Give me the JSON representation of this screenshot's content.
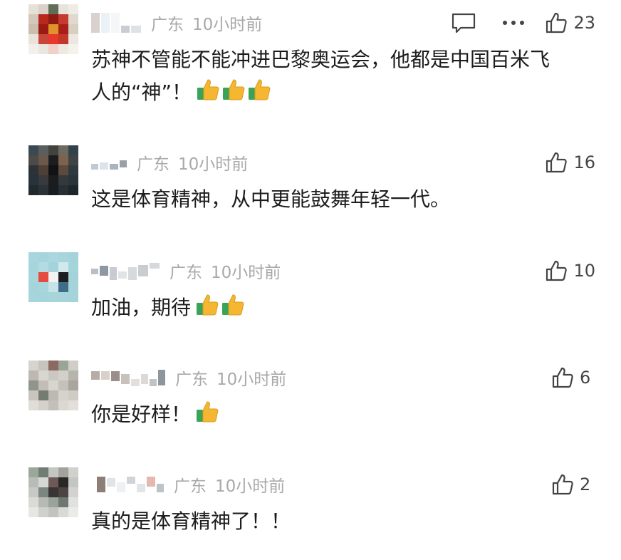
{
  "comments": [
    {
      "location": "广东",
      "time": "10小时前",
      "text": "苏神不管能不能冲进巴黎奥运会，他都是中国百米飞",
      "text2": "人的“神”！",
      "emoji_icons": [
        "thumbs-up-icon",
        "thumbs-up-icon",
        "thumbs-up-icon"
      ],
      "likes": "23",
      "show_reply_and_more": true
    },
    {
      "location": "广东",
      "time": "10小时前",
      "text": "这是体育精神，从中更能鼓舞年轻一代。",
      "likes": "16"
    },
    {
      "location": "广东",
      "time": "10小时前",
      "text": "加油，期待",
      "emoji_icons": [
        "thumbs-up-icon",
        "thumbs-up-icon"
      ],
      "likes": "10"
    },
    {
      "location": "广东",
      "time": "10小时前",
      "text": "你是好样！",
      "emoji_icons": [
        "thumbs-up-icon"
      ],
      "likes": "6"
    },
    {
      "location": "广东",
      "time": "10小时前",
      "text": "真的是体育精神了！！",
      "likes": "2"
    }
  ],
  "colors": {
    "meta_gray": "#a9a9a9",
    "text": "#1d1d1d",
    "icon": "#444444",
    "thumb_yellow": "#f5b731",
    "thumb_green": "#3aa357"
  }
}
